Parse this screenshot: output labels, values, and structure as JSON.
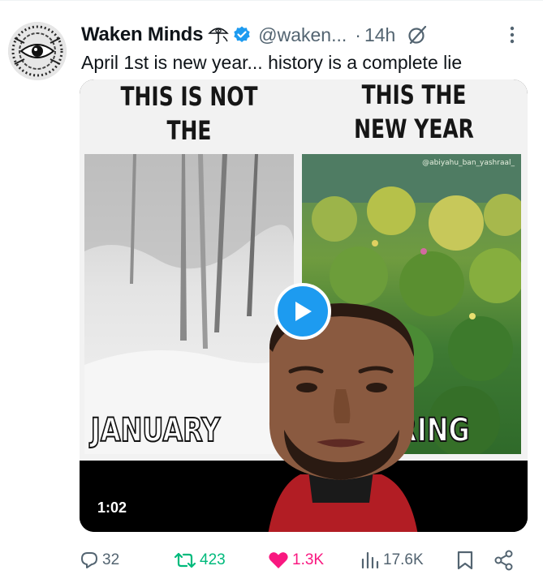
{
  "tweet": {
    "author_name": "Waken Minds",
    "name_emoji": "umbrella-eye-emoji",
    "handle": "@waken...",
    "separator": "·",
    "time": "14h",
    "text": "April 1st is new year... history is a complete lie"
  },
  "media": {
    "headline_left": "THIS IS NOT THE\nNEW YEAR",
    "headline_right": "THIS THE\nNEW YEAR",
    "watermark": "@abiyahu_ban_yashraal_",
    "caption_left": "JANUARY",
    "caption_right": "RING",
    "duration": "1:02"
  },
  "actions": {
    "replies": "32",
    "reposts": "423",
    "likes": "1.3K",
    "views": "17.6K"
  },
  "colors": {
    "text": "#0f1419",
    "secondary": "#536471",
    "verified": "#1d9bf0",
    "repost_active": "#00ba7c",
    "like_active": "#f91880",
    "play_button": "#1d9bf0"
  }
}
